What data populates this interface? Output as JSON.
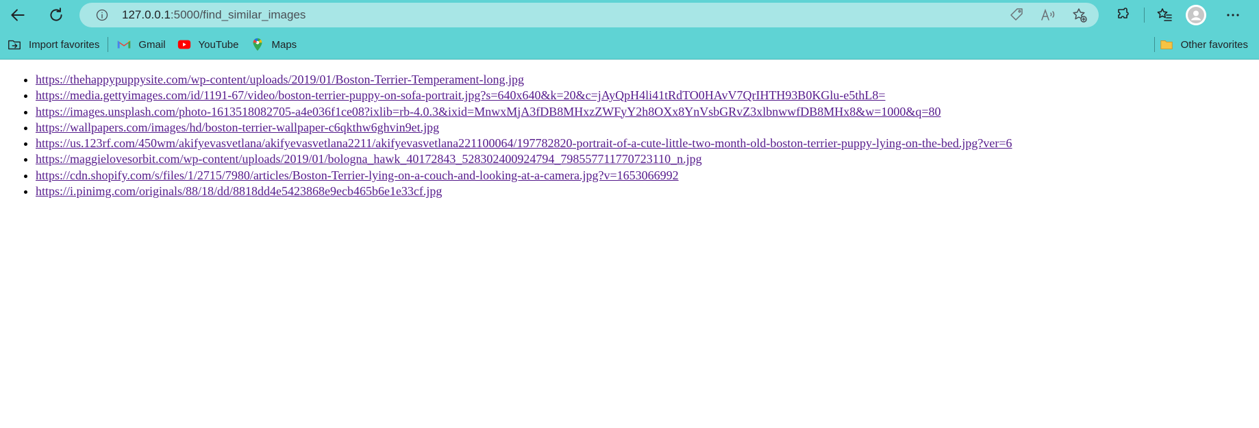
{
  "browser": {
    "url_host": "127.0.0.1",
    "url_path": ":5000/find_similar_images",
    "favorites": [
      {
        "label": "Import favorites",
        "icon": "import-icon"
      },
      {
        "label": "Gmail",
        "icon": "gmail-icon"
      },
      {
        "label": "YouTube",
        "icon": "youtube-icon"
      },
      {
        "label": "Maps",
        "icon": "maps-icon"
      }
    ],
    "other_favorites": "Other favorites"
  },
  "links": [
    "https://thehappypuppysite.com/wp-content/uploads/2019/01/Boston-Terrier-Temperament-long.jpg",
    "https://media.gettyimages.com/id/1191-67/video/boston-terrier-puppy-on-sofa-portrait.jpg?s=640x640&k=20&c=jAyQpH4li41tRdTO0HAvV7QrIHTH93B0KGlu-e5thL8=",
    "https://images.unsplash.com/photo-1613518082705-a4e036f1ce08?ixlib=rb-4.0.3&ixid=MnwxMjA3fDB8MHxzZWFyY2h8OXx8YnVsbGRvZ3xlbnwwfDB8MHx8&w=1000&q=80",
    "https://wallpapers.com/images/hd/boston-terrier-wallpaper-c6qkthw6ghvin9et.jpg",
    "https://us.123rf.com/450wm/akifyevasvetlana/akifyevasvetlana2211/akifyevasvetlana221100064/197782820-portrait-of-a-cute-little-two-month-old-boston-terrier-puppy-lying-on-the-bed.jpg?ver=6",
    "https://maggielovesorbit.com/wp-content/uploads/2019/01/bologna_hawk_40172843_528302400924794_798557711770723110_n.jpg",
    "https://cdn.shopify.com/s/files/1/2715/7980/articles/Boston-Terrier-lying-on-a-couch-and-looking-at-a-camera.jpg?v=1653066992",
    "https://i.pinimg.com/originals/88/18/dd/8818dd4e5423868e9ecb465b6e1e33cf.jpg"
  ]
}
